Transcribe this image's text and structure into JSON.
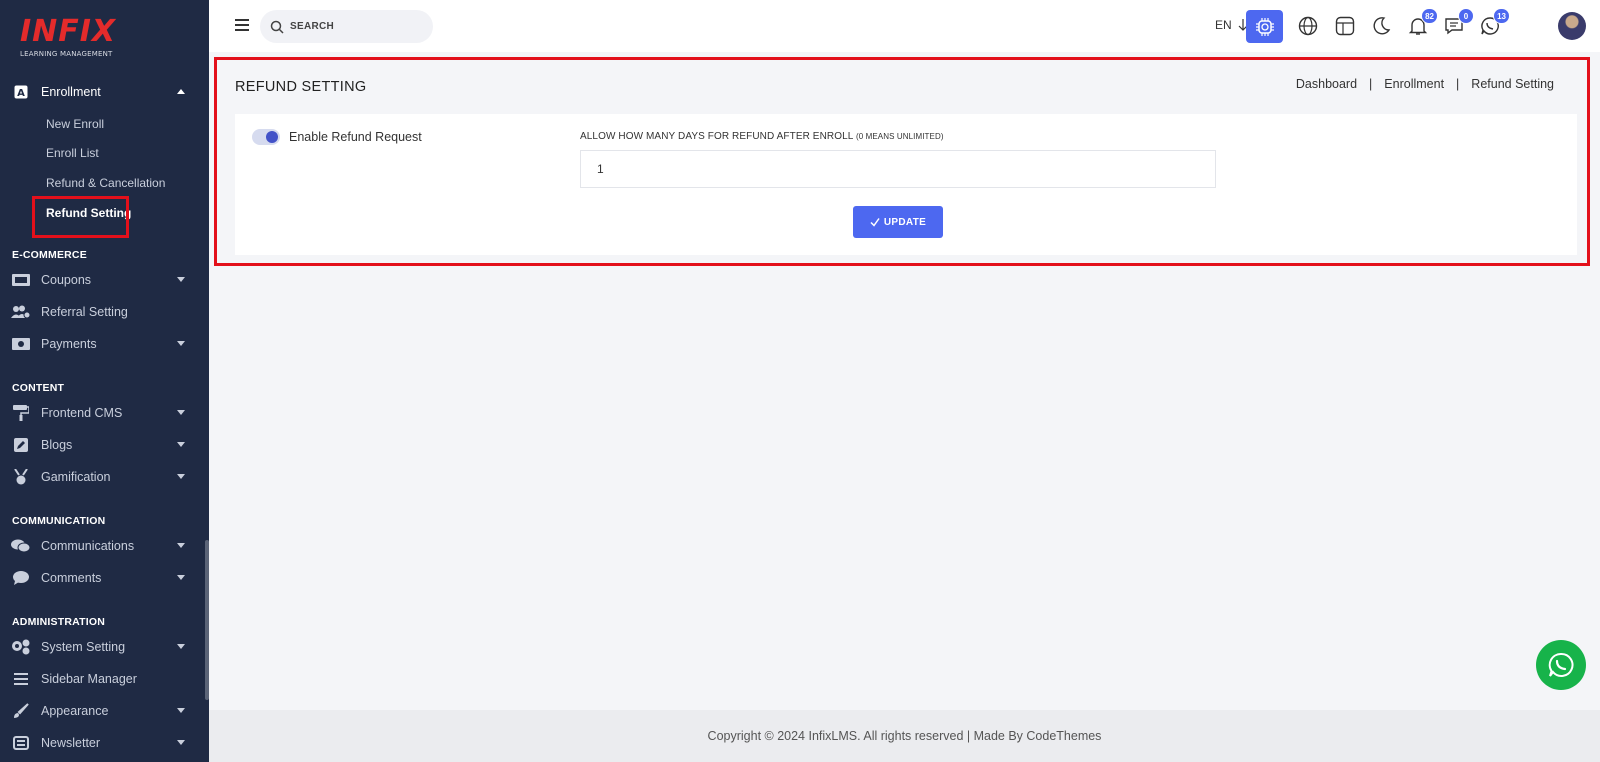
{
  "logo": {
    "brand": "INFIX",
    "subtitle": "LEARNING MANAGEMENT"
  },
  "sidebar": {
    "enrollment": {
      "label": "Enrollment",
      "icon": "letter-a-icon"
    },
    "enrollment_sub": [
      "New Enroll",
      "Enroll List",
      "Refund & Cancellation",
      "Refund Setting"
    ],
    "sections": {
      "ecommerce": "E-COMMERCE",
      "content": "CONTENT",
      "communication": "COMMUNICATION",
      "administration": "ADMINISTRATION"
    },
    "items": {
      "coupons": "Coupons",
      "referral": "Referral Setting",
      "payments": "Payments",
      "frontend_cms": "Frontend CMS",
      "blogs": "Blogs",
      "gamification": "Gamification",
      "communications": "Communications",
      "comments": "Comments",
      "system_setting": "System Setting",
      "sidebar_manager": "Sidebar Manager",
      "appearance": "Appearance",
      "newsletter": "Newsletter"
    }
  },
  "header": {
    "search_placeholder": "SEARCH",
    "language": "EN",
    "badges": {
      "notifications": "82",
      "messages": "0",
      "whatsapp": "13"
    }
  },
  "page": {
    "title": "REFUND SETTING",
    "breadcrumb": [
      "Dashboard",
      "Enrollment",
      "Refund Setting"
    ],
    "toggle_label": "Enable Refund Request",
    "toggle_on": true,
    "field_label": "ALLOW HOW MANY DAYS FOR REFUND AFTER ENROLL",
    "field_label_note": "(0 MEANS UNLIMITED)",
    "field_value": "1",
    "update_label": "UPDATE"
  },
  "footer": {
    "text": "Copyright © 2024 InfixLMS. All rights reserved | Made By CodeThemes"
  },
  "colors": {
    "sidebar_bg": "#1f2a44",
    "accent": "#4d68f0",
    "highlight": "#e3101b",
    "whatsapp": "#17b34a"
  }
}
